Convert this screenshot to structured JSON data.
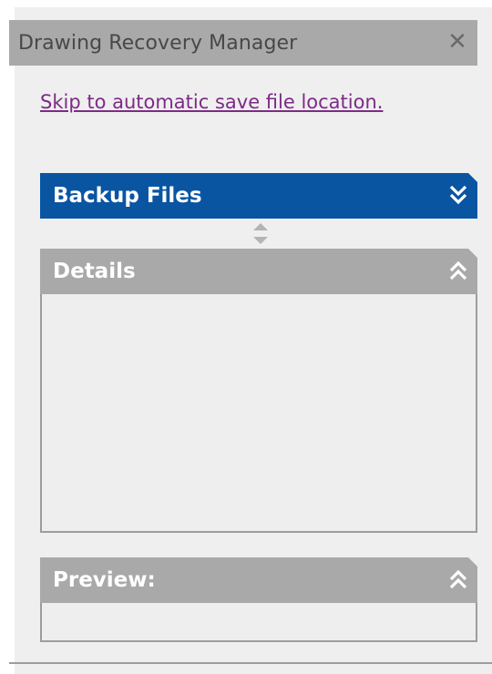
{
  "window": {
    "title": "Drawing Recovery Manager",
    "close_glyph": "✕",
    "colors": {
      "title_bar": "#a9a9a9",
      "background": "#efefef",
      "link": "#7d2b86",
      "active_panel": "#0a55a2",
      "inactive_panel": "#a9a9a9"
    }
  },
  "links": {
    "skip": "Skip to automatic save file location."
  },
  "panels": [
    {
      "label": "Backup Files",
      "state": "collapsed",
      "chevron_icon": "double-chevron-down-icon"
    },
    {
      "label": "Details",
      "state": "expanded",
      "chevron_icon": "double-chevron-up-icon"
    },
    {
      "label": "Preview:",
      "state": "expanded",
      "chevron_icon": "double-chevron-up-icon"
    }
  ]
}
